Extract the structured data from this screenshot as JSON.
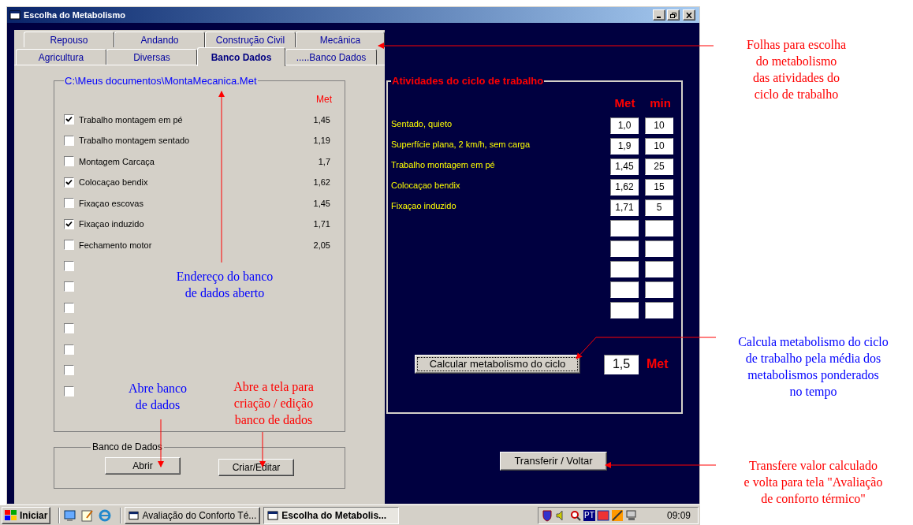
{
  "window": {
    "title": "Escolha do Metabolismo"
  },
  "tabs": [
    [
      {
        "label": "Repouso",
        "selected": false
      },
      {
        "label": "Andando",
        "selected": false
      },
      {
        "label": "Construção Civil",
        "selected": false
      },
      {
        "label": "Mecânica",
        "selected": false
      }
    ],
    [
      {
        "label": "Agricultura",
        "selected": false
      },
      {
        "label": "Diversas",
        "selected": false
      },
      {
        "label": "Banco Dados",
        "selected": true
      },
      {
        "label": ".....Banco Dados",
        "selected": false
      }
    ]
  ],
  "database_list": {
    "title": "C:\\Meus documentos\\MontaMecanica.Met",
    "column_header": "Met",
    "items": [
      {
        "label": "Trabalho montagem em pé",
        "checked": true,
        "met": "1,45"
      },
      {
        "label": "Trabalho montagem sentado",
        "checked": false,
        "met": "1,19"
      },
      {
        "label": "Montagem Carcaça",
        "checked": false,
        "met": "1,7"
      },
      {
        "label": "Colocaçao bendix",
        "checked": true,
        "met": "1,62"
      },
      {
        "label": "Fixaçao escovas",
        "checked": false,
        "met": "1,45"
      },
      {
        "label": "Fixaçao induzido",
        "checked": true,
        "met": "1,71"
      },
      {
        "label": "Fechamento motor",
        "checked": false,
        "met": "2,05"
      },
      {
        "checked": false
      },
      {
        "checked": false
      },
      {
        "checked": false
      },
      {
        "checked": false
      },
      {
        "checked": false
      },
      {
        "checked": false
      },
      {
        "checked": false
      }
    ]
  },
  "database_box": {
    "title": "Banco de Dados",
    "buttons": [
      "Abrir",
      "Criar/Editar"
    ]
  },
  "cycle": {
    "title": "Atividades do ciclo de trabalho",
    "headers": [
      "Met",
      "min"
    ],
    "rows": [
      {
        "activity": "Sentado, quieto",
        "met": "1,0",
        "min": "10"
      },
      {
        "activity": "Superfície plana, 2 km/h, sem carga",
        "met": "1,9",
        "min": "10"
      },
      {
        "activity": "Trabalho montagem em pé",
        "met": "1,45",
        "min": "25"
      },
      {
        "activity": "Colocaçao bendix",
        "met": "1,62",
        "min": "15"
      },
      {
        "activity": "Fixaçao induzido",
        "met": "1,71",
        "min": "5"
      },
      {},
      {},
      {},
      {},
      {}
    ],
    "calculate_button": "Calcular metabolismo do ciclo",
    "result": "1,5",
    "result_unit": "Met"
  },
  "transfer_button": "Transferir / Voltar",
  "taskbar": {
    "start": "Iniciar",
    "tasks": [
      {
        "label": "Avaliação do Conforto Té...",
        "selected": false
      },
      {
        "label": "Escolha do Metabolis...",
        "selected": true
      }
    ],
    "language": "PT",
    "clock": "09:09"
  },
  "annotations": [
    {
      "text": "Folhas para escolha\ndo metabolismo\ndas atividades do\nciclo de trabalho",
      "color": "#ff0000"
    },
    {
      "text": "Endereço do banco\nde dados aberto",
      "color": "#0000ff"
    },
    {
      "text": "Abre banco\nde dados",
      "color": "#0000ff"
    },
    {
      "text": "Abre  a tela para\ncriação / edição\nbanco de dados",
      "color": "#ff0000"
    },
    {
      "text": "Calcula metabolismo do ciclo\nde trabalho pela média dos\nmetabolismos ponderados\nno tempo",
      "color": "#0000ff"
    },
    {
      "text": "Transfere valor calculado\ne volta para tela \"Avaliação\nde conforto térmico\"",
      "color": "#ff0000"
    }
  ]
}
